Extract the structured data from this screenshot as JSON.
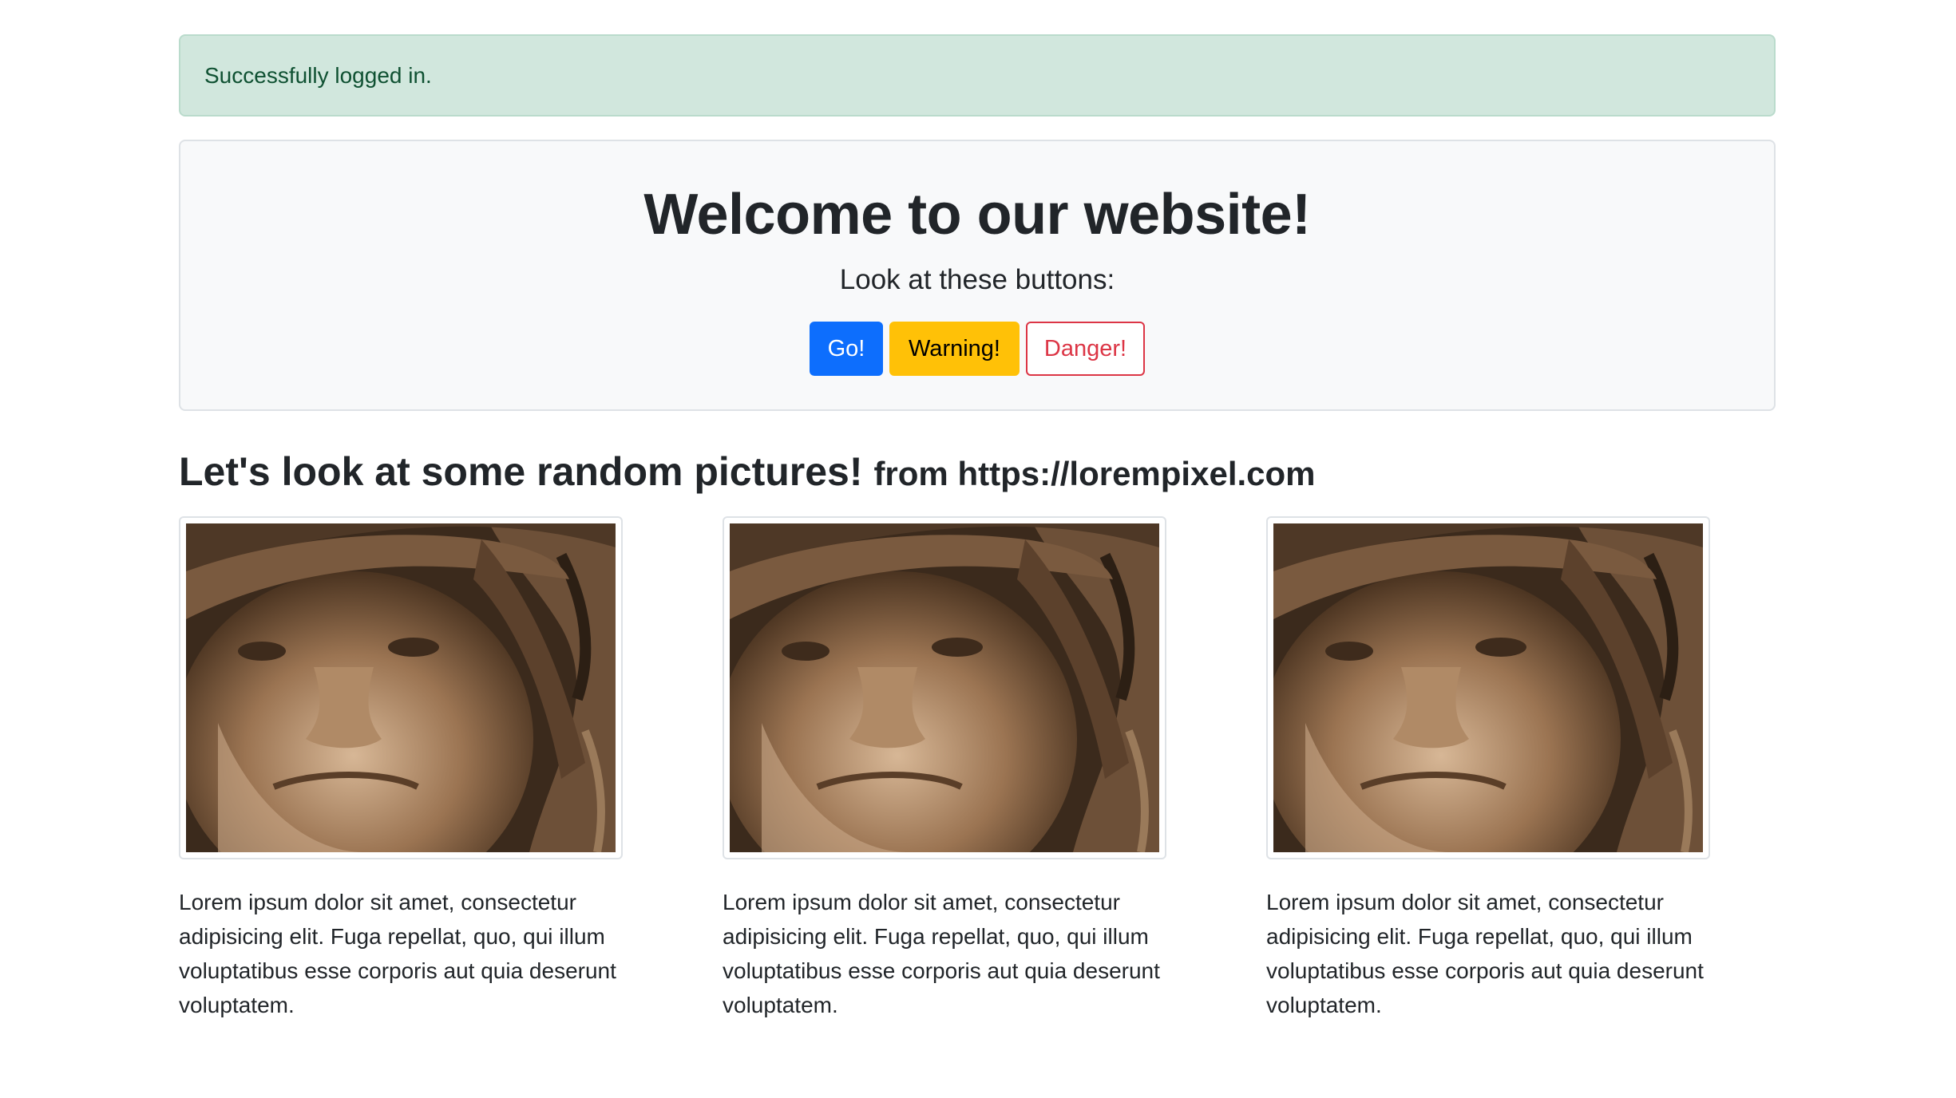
{
  "alert": {
    "message": "Successfully logged in."
  },
  "hero": {
    "title": "Welcome to our website!",
    "lead": "Look at these buttons:",
    "buttons": {
      "go": "Go!",
      "warning": "Warning!",
      "danger": "Danger!"
    }
  },
  "gallery": {
    "title": "Let's look at some random pictures!",
    "source": "from https://lorempixel.com",
    "items": [
      {
        "image": "sepia-portrait-elderly-person-with-hat",
        "caption": "Lorem ipsum dolor sit amet, consectetur adipisicing elit. Fuga repellat, quo, qui illum voluptatibus esse corporis aut quia deserunt voluptatem."
      },
      {
        "image": "sepia-portrait-elderly-person-with-hat",
        "caption": "Lorem ipsum dolor sit amet, consectetur adipisicing elit. Fuga repellat, quo, qui illum voluptatibus esse corporis aut quia deserunt voluptatem."
      },
      {
        "image": "sepia-portrait-elderly-person-with-hat",
        "caption": "Lorem ipsum dolor sit amet, consectetur adipisicing elit. Fuga repellat, quo, qui illum voluptatibus esse corporis aut quia deserunt voluptatem."
      }
    ]
  },
  "colors": {
    "alert_bg": "#d1e7dd",
    "alert_text": "#0f5132",
    "primary": "#0d6efd",
    "warning": "#ffc107",
    "danger": "#dc3545",
    "jumbo_bg": "#f8f9fa"
  }
}
